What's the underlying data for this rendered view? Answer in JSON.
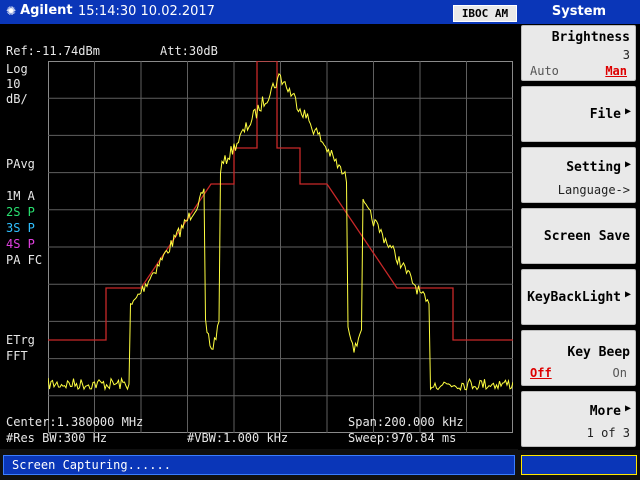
{
  "topbar": {
    "brand": "Agilent",
    "datetime": "15:14:30 10.02.2017",
    "mode": "IBOC AM",
    "menu_title": "System"
  },
  "analyzer": {
    "ref": "Ref:-11.74dBm",
    "att": "Att:30dB",
    "scale_line1": "Log",
    "scale_line2": "10",
    "scale_line3": "dB/",
    "pavg": "PAvg",
    "trace1": "1M A",
    "trace2": "2S P",
    "trace3": "3S P",
    "trace4": "4S P",
    "pafc": "PA FC",
    "etrg": "ETrg",
    "fft": "FFT",
    "center": "Center:1.380000 MHz",
    "span": "Span:200.000 kHz",
    "res_bw": "#Res BW:300 Hz",
    "vbw": "#VBW:1.000 kHz",
    "sweep": "Sweep:970.84 ms"
  },
  "colors": {
    "trace": "#ffff40",
    "mask": "#c82828",
    "grid": "#7a7a7a",
    "trace2": "#28e070",
    "trace3": "#30c0ff",
    "trace4": "#e040e0"
  },
  "softkeys": {
    "brightness_label": "Brightness",
    "brightness_value": "3",
    "brightness_auto": "Auto",
    "brightness_man": "Man",
    "file_label": "File",
    "setting_label": "Setting",
    "setting_sub": "Language->",
    "screen_save_label": "Screen Save",
    "keybacklight_label": "KeyBackLight",
    "keybeep_label": "Key Beep",
    "keybeep_off": "Off",
    "keybeep_on": "On",
    "more_label": "More",
    "more_page": "1 of 3"
  },
  "status": {
    "message": "Screen Capturing......"
  }
}
